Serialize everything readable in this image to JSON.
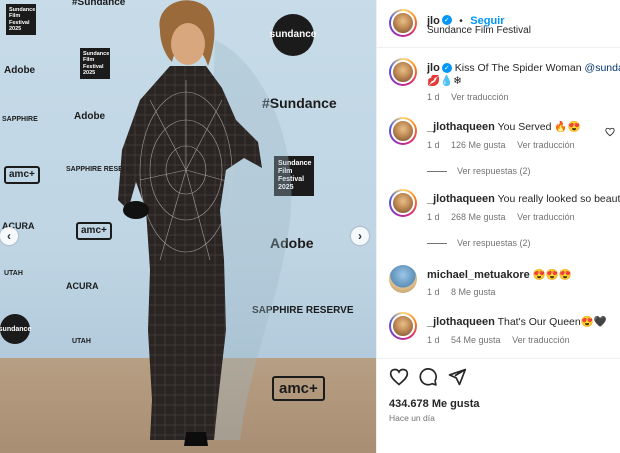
{
  "photo": {
    "logos": {
      "sundance_top": "#Sundance",
      "sundance_mid": "#Sundance",
      "adobe_1": "Adobe",
      "adobe_2": "Adobe",
      "adobe_3": "Adobe",
      "sapphire_1": "SAPPHIRE",
      "sapphire_2": "SAPPHIRE RESERVE",
      "sapphire_3": "SAPPHIRE RESERVE",
      "acura_1": "ACURA",
      "acura_2": "ACURA",
      "utah_1": "UTAH",
      "utah_2": "UTAH",
      "amc_1": "amc+",
      "amc_2": "amc+",
      "amc_3": "amc+",
      "sundance_circle": "sundance",
      "sundance_circle_2": "sundance",
      "sff_box_1": "Sundance Film Festival 2025",
      "sff_box_2": "Sundance Film Festival 2025",
      "sff_box_3": "Sundance Film Festival 2025"
    },
    "prev_arrow": "‹",
    "next_arrow": "›"
  },
  "header": {
    "username": "jlo",
    "separator": "•",
    "follow_label": "Seguir",
    "location": "Sundance Film Festival",
    "more_label": "···"
  },
  "caption": {
    "username": "jlo",
    "text": "Kiss Of The Spider Woman",
    "mention": "@sundance",
    "emojis": "💋💧❄",
    "time": "1 d",
    "translate": "Ver traducción"
  },
  "comments": [
    {
      "username": "_jlothaqueen",
      "text": "You Served 🔥😍",
      "time": "1 d",
      "likes": "126 Me gusta",
      "translate": "Ver traducción",
      "replies": "Ver respuestas (2)"
    },
    {
      "username": "_jlothaqueen",
      "text": "You really looked so beautiful",
      "time": "1 d",
      "likes": "268 Me gusta",
      "translate": "Ver traducción",
      "replies": "Ver respuestas (2)"
    },
    {
      "username": "michael_metuakore",
      "text": "😍😍😍",
      "time": "1 d",
      "likes": "8 Me gusta",
      "translate": "",
      "replies": ""
    },
    {
      "username": "_jlothaqueen",
      "text": "That's Our Queen😍🖤",
      "time": "1 d",
      "likes": "54 Me gusta",
      "translate": "Ver traducción",
      "replies": ""
    }
  ],
  "actions": {
    "likes": "434.678 Me gusta",
    "time": "Hace un día",
    "icons": [
      "heart-icon",
      "comment-icon",
      "share-icon",
      "bookmark-icon"
    ]
  },
  "colors": {
    "accent": "#0095f6",
    "muted": "#737373",
    "text": "#262626"
  }
}
